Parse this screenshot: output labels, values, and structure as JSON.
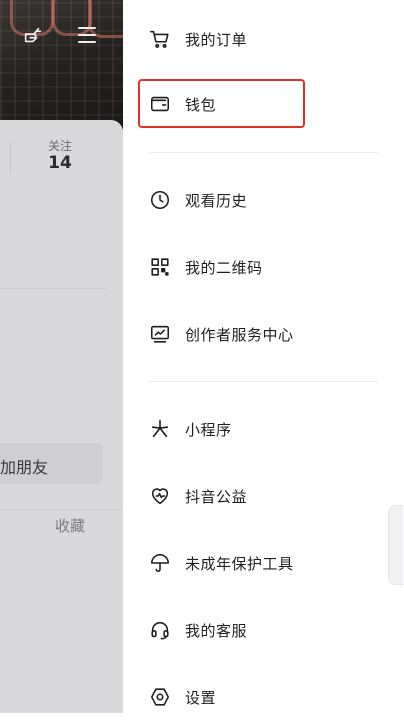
{
  "background": {
    "follow_label": "关注",
    "follow_count": "14",
    "add_friends_text": "加朋友",
    "favorites_text": "收藏"
  },
  "drawer": {
    "items": [
      {
        "label": "我的订单",
        "icon": "cart-icon"
      },
      {
        "label": "钱包",
        "icon": "wallet-icon",
        "highlighted": true
      },
      {
        "label": "观看历史",
        "icon": "clock-icon"
      },
      {
        "label": "我的二维码",
        "icon": "qrcode-icon"
      },
      {
        "label": "创作者服务中心",
        "icon": "monitor-chart-icon"
      },
      {
        "label": "小程序",
        "icon": "miniprogram-icon"
      },
      {
        "label": "抖音公益",
        "icon": "heart-pulse-icon"
      },
      {
        "label": "未成年保护工具",
        "icon": "umbrella-icon"
      },
      {
        "label": "我的客服",
        "icon": "headset-icon"
      },
      {
        "label": "设置",
        "icon": "settings-hexagon-icon"
      }
    ]
  },
  "colors": {
    "highlight_border": "#e0302b",
    "text": "#1f1f21",
    "overlay": "#d9d9db"
  }
}
